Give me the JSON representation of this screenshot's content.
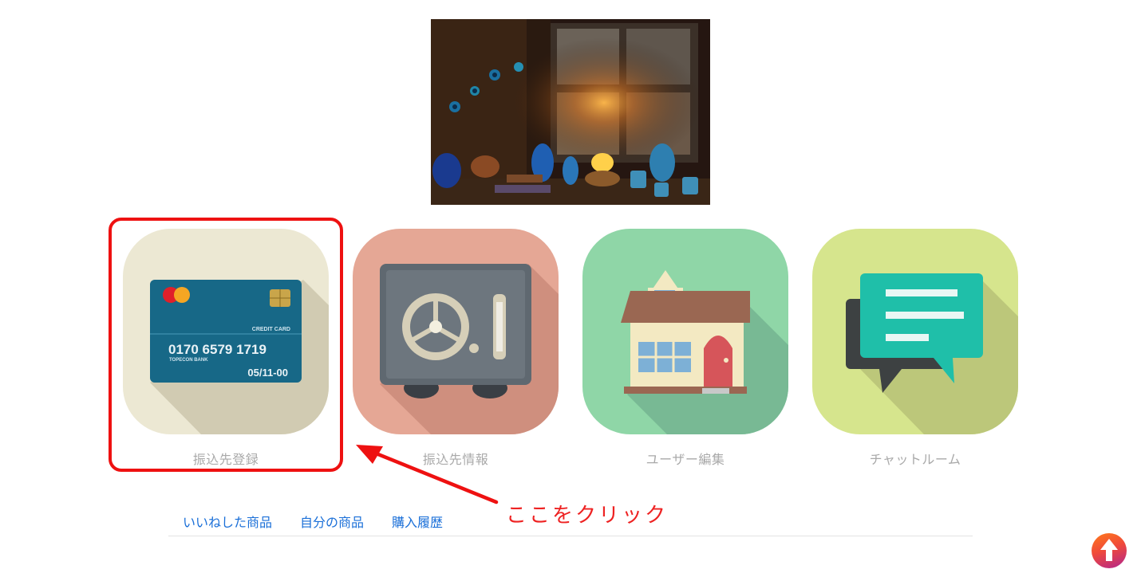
{
  "hero": {
    "icon": "still-life-photo"
  },
  "tiles": [
    {
      "label": "振込先登録",
      "icon": "credit-card-icon",
      "bg": "#ece8d3",
      "text": {
        "card_title": "CREDIT CARD",
        "card_number": "0170  6579  1719",
        "bank_name": "TOPECON BANK",
        "expiry": "05/11-00"
      }
    },
    {
      "label": "振込先情報",
      "icon": "safe-icon",
      "bg": "#e5a795"
    },
    {
      "label": "ユーザー編集",
      "icon": "house-icon",
      "bg": "#8fd6a7"
    },
    {
      "label": "チャットルーム",
      "icon": "chat-bubbles-icon",
      "bg": "#d6e58d"
    }
  ],
  "annotation": {
    "callout": "ここをクリック",
    "color": "#ee1111"
  },
  "tabs": [
    {
      "label": "いいねした商品"
    },
    {
      "label": "自分の商品"
    },
    {
      "label": "購入履歴"
    }
  ],
  "scroll_top": {
    "icon": "arrow-up-icon"
  },
  "colors": {
    "link": "#1a6fd8",
    "label": "#a9a9a9"
  }
}
